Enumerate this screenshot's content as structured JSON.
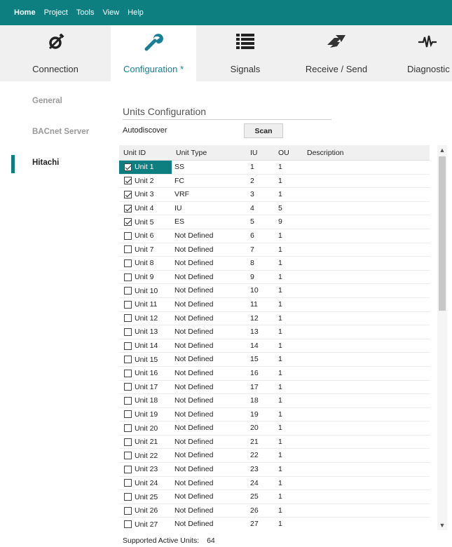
{
  "menu": [
    "Home",
    "Project",
    "Tools",
    "View",
    "Help"
  ],
  "tabs": [
    {
      "label": "Connection",
      "icon": "plug-icon",
      "active": false
    },
    {
      "label": "Configuration *",
      "icon": "wrench-icon",
      "active": true
    },
    {
      "label": "Signals",
      "icon": "list-icon",
      "active": false
    },
    {
      "label": "Receive / Send",
      "icon": "send-receive-icon",
      "active": false
    },
    {
      "label": "Diagnostic",
      "icon": "pulse-icon",
      "active": false
    }
  ],
  "nav": [
    {
      "label": "General",
      "active": false
    },
    {
      "label": "BACnet Server",
      "active": false
    },
    {
      "label": "Hitachi",
      "active": true
    }
  ],
  "section_title": "Units Configuration",
  "autodiscover_label": "Autodiscover",
  "scan_label": "Scan",
  "columns": {
    "id": "Unit ID",
    "type": "Unit Type",
    "iu": "IU",
    "ou": "OU",
    "desc": "Description"
  },
  "units": [
    {
      "id": "Unit 1",
      "checked": true,
      "type": "SS",
      "iu": "1",
      "ou": "1",
      "desc": ""
    },
    {
      "id": "Unit 2",
      "checked": true,
      "type": "FC",
      "iu": "2",
      "ou": "1",
      "desc": ""
    },
    {
      "id": "Unit 3",
      "checked": true,
      "type": "VRF",
      "iu": "3",
      "ou": "1",
      "desc": ""
    },
    {
      "id": "Unit 4",
      "checked": true,
      "type": "IU",
      "iu": "4",
      "ou": "5",
      "desc": ""
    },
    {
      "id": "Unit 5",
      "checked": true,
      "type": "ES",
      "iu": "5",
      "ou": "9",
      "desc": ""
    },
    {
      "id": "Unit 6",
      "checked": false,
      "type": "Not Defined",
      "iu": "6",
      "ou": "1",
      "desc": ""
    },
    {
      "id": "Unit 7",
      "checked": false,
      "type": "Not Defined",
      "iu": "7",
      "ou": "1",
      "desc": ""
    },
    {
      "id": "Unit 8",
      "checked": false,
      "type": "Not Defined",
      "iu": "8",
      "ou": "1",
      "desc": ""
    },
    {
      "id": "Unit 9",
      "checked": false,
      "type": "Not Defined",
      "iu": "9",
      "ou": "1",
      "desc": ""
    },
    {
      "id": "Unit 10",
      "checked": false,
      "type": "Not Defined",
      "iu": "10",
      "ou": "1",
      "desc": ""
    },
    {
      "id": "Unit 11",
      "checked": false,
      "type": "Not Defined",
      "iu": "11",
      "ou": "1",
      "desc": ""
    },
    {
      "id": "Unit 12",
      "checked": false,
      "type": "Not Defined",
      "iu": "12",
      "ou": "1",
      "desc": ""
    },
    {
      "id": "Unit 13",
      "checked": false,
      "type": "Not Defined",
      "iu": "13",
      "ou": "1",
      "desc": ""
    },
    {
      "id": "Unit 14",
      "checked": false,
      "type": "Not Defined",
      "iu": "14",
      "ou": "1",
      "desc": ""
    },
    {
      "id": "Unit 15",
      "checked": false,
      "type": "Not Defined",
      "iu": "15",
      "ou": "1",
      "desc": ""
    },
    {
      "id": "Unit 16",
      "checked": false,
      "type": "Not Defined",
      "iu": "16",
      "ou": "1",
      "desc": ""
    },
    {
      "id": "Unit 17",
      "checked": false,
      "type": "Not Defined",
      "iu": "17",
      "ou": "1",
      "desc": ""
    },
    {
      "id": "Unit 18",
      "checked": false,
      "type": "Not Defined",
      "iu": "18",
      "ou": "1",
      "desc": ""
    },
    {
      "id": "Unit 19",
      "checked": false,
      "type": "Not Defined",
      "iu": "19",
      "ou": "1",
      "desc": ""
    },
    {
      "id": "Unit 20",
      "checked": false,
      "type": "Not Defined",
      "iu": "20",
      "ou": "1",
      "desc": ""
    },
    {
      "id": "Unit 21",
      "checked": false,
      "type": "Not Defined",
      "iu": "21",
      "ou": "1",
      "desc": ""
    },
    {
      "id": "Unit 22",
      "checked": false,
      "type": "Not Defined",
      "iu": "22",
      "ou": "1",
      "desc": ""
    },
    {
      "id": "Unit 23",
      "checked": false,
      "type": "Not Defined",
      "iu": "23",
      "ou": "1",
      "desc": ""
    },
    {
      "id": "Unit 24",
      "checked": false,
      "type": "Not Defined",
      "iu": "24",
      "ou": "1",
      "desc": ""
    },
    {
      "id": "Unit 25",
      "checked": false,
      "type": "Not Defined",
      "iu": "25",
      "ou": "1",
      "desc": ""
    },
    {
      "id": "Unit 26",
      "checked": false,
      "type": "Not Defined",
      "iu": "26",
      "ou": "1",
      "desc": ""
    },
    {
      "id": "Unit 27",
      "checked": false,
      "type": "Not Defined",
      "iu": "27",
      "ou": "1",
      "desc": ""
    }
  ],
  "footer": {
    "label": "Supported Active Units:",
    "value": "64"
  },
  "colors": {
    "accent": "#0e7f80",
    "toolbar_bg": "#f0f0f0"
  }
}
